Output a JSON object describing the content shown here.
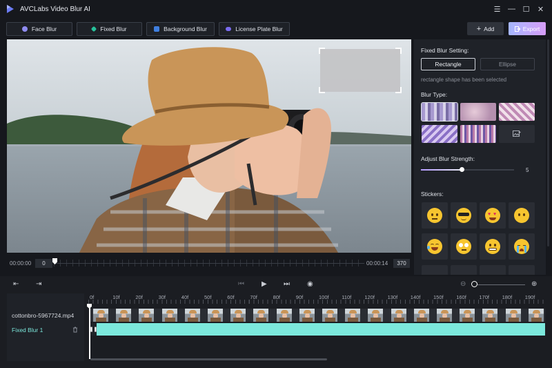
{
  "app": {
    "title": "AVCLabs Video Blur AI"
  },
  "window_controls": {
    "menu": "☰",
    "minimize": "—",
    "maximize": "☐",
    "close": "✕"
  },
  "modes": [
    {
      "label": "Face Blur",
      "icon": "face-icon",
      "color": "#8f8cf0"
    },
    {
      "label": "Fixed Blur",
      "icon": "fixed-blur-icon",
      "color": "#27c29b"
    },
    {
      "label": "Background Blur",
      "icon": "background-icon",
      "color": "#3f7fe0"
    },
    {
      "label": "License Plate Blur",
      "icon": "car-icon",
      "color": "#7a6cf0"
    }
  ],
  "actions": {
    "add_label": "Add",
    "export_label": "Export"
  },
  "scrubber": {
    "start_time": "00:00:00",
    "start_frame": "0",
    "end_time": "00:00:14",
    "end_frame": "370",
    "position": 0.0
  },
  "panel": {
    "setting_title": "Fixed Blur Setting:",
    "shape_rectangle": "Rectangle",
    "shape_ellipse": "Ellipse",
    "shape_note": "rectangle shape has been selected",
    "blur_type_title": "Blur Type:",
    "blur_strength_title": "Adjust Blur Strength:",
    "blur_strength_value": "5",
    "blur_strength_fraction": 0.44,
    "stickers_title": "Stickers:",
    "stickers": [
      "neutral-face-emoji",
      "sunglasses-emoji",
      "heart-eyes-emoji",
      "blank-face-emoji",
      "laughing-tears-emoji",
      "eye-roll-emoji",
      "grimace-emoji",
      "crying-emoji"
    ]
  },
  "timeline": {
    "ruler_labels": [
      "0f",
      "10f",
      "20f",
      "30f",
      "40f",
      "50f",
      "60f",
      "70f",
      "80f",
      "90f",
      "100f",
      "110f",
      "120f",
      "130f",
      "140f",
      "150f",
      "160f",
      "170f",
      "180f",
      "190f"
    ],
    "video_track_label": "cottonbro-5967724.mp4",
    "blur_track_label": "Fixed Blur 1",
    "blur_track_color": "#7ce8dc",
    "zoom_fraction": 0.0
  }
}
